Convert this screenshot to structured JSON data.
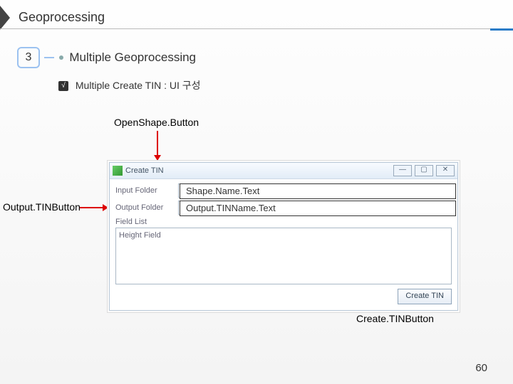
{
  "title": "Geoprocessing",
  "section": {
    "number": "3",
    "title": "Multiple Geoprocessing"
  },
  "bullet": {
    "mark": "√",
    "text": "Multiple Create TIN : UI 구성"
  },
  "annotations": {
    "openShapeButton": "OpenShape.Button",
    "outputTinButton": "Output.TINButton",
    "shapeNameText": "Shape.Name.Text",
    "outputTinNameText": "Output.TINName.Text",
    "createTinButton": "Create.TINButton"
  },
  "dialog": {
    "title": "Create TIN",
    "windowButtons": {
      "min": "—",
      "max": "▢",
      "close": "✕"
    },
    "rows": {
      "inputFolder": {
        "label": "Input Folder",
        "browse": "…"
      },
      "outputFolder": {
        "label": "Output Folder",
        "browse": "…"
      }
    },
    "fieldListLabel": "Field List",
    "heightFieldLabel": "Height Field",
    "createButton": "Create TIN"
  },
  "pageNumber": "60"
}
